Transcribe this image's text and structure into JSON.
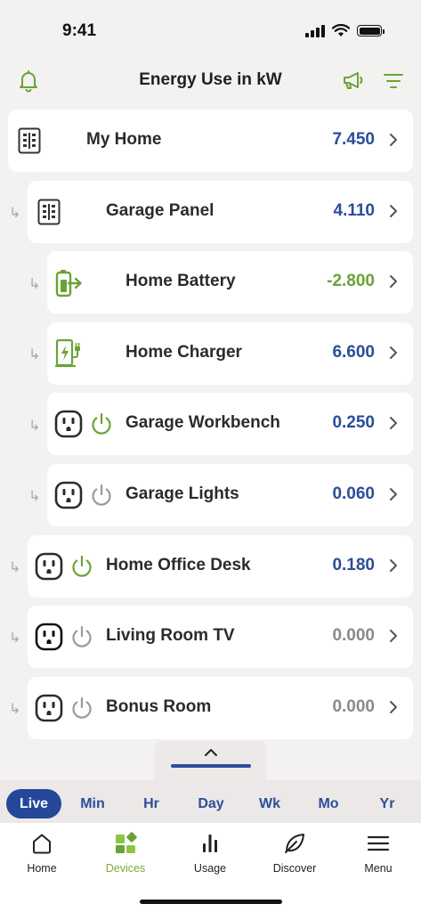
{
  "status_bar": {
    "time": "9:41"
  },
  "header": {
    "title": "Energy Use in kW"
  },
  "colors": {
    "accent_green": "#6aa335",
    "value_blue": "#2b4d9a",
    "value_gray": "#8a8a8a",
    "active_tab": "#24479a"
  },
  "devices": [
    {
      "name": "My Home",
      "value": "7.450",
      "icon": "panel-icon",
      "power": "none",
      "value_color": "blue"
    },
    {
      "name": "Garage Panel",
      "value": "4.110",
      "icon": "panel-icon",
      "power": "none",
      "value_color": "blue"
    },
    {
      "name": "Home Battery",
      "value": "-2.800",
      "icon": "battery-icon",
      "power": "none",
      "value_color": "green"
    },
    {
      "name": "Home Charger",
      "value": "6.600",
      "icon": "ev-charger-icon",
      "power": "none",
      "value_color": "blue"
    },
    {
      "name": "Garage Workbench",
      "value": "0.250",
      "icon": "outlet-icon",
      "power": "on",
      "value_color": "blue"
    },
    {
      "name": "Garage Lights",
      "value": "0.060",
      "icon": "outlet-icon",
      "power": "off",
      "value_color": "blue"
    },
    {
      "name": "Home Office Desk",
      "value": "0.180",
      "icon": "outlet-icon",
      "power": "on",
      "value_color": "blue"
    },
    {
      "name": "Living Room TV",
      "value": "0.000",
      "icon": "outlet-icon",
      "power": "off",
      "value_color": "gray"
    },
    {
      "name": "Bonus Room",
      "value": "0.000",
      "icon": "outlet-icon",
      "power": "off",
      "value_color": "gray"
    }
  ],
  "time_ranges": [
    {
      "label": "Live",
      "active": true
    },
    {
      "label": "Min",
      "active": false
    },
    {
      "label": "Hr",
      "active": false
    },
    {
      "label": "Day",
      "active": false
    },
    {
      "label": "Wk",
      "active": false
    },
    {
      "label": "Mo",
      "active": false
    },
    {
      "label": "Yr",
      "active": false
    }
  ],
  "tabs": [
    {
      "label": "Home",
      "icon": "house-icon",
      "active": false
    },
    {
      "label": "Devices",
      "icon": "devices-icon",
      "active": true
    },
    {
      "label": "Usage",
      "icon": "bar-chart-icon",
      "active": false
    },
    {
      "label": "Discover",
      "icon": "leaf-icon",
      "active": false
    },
    {
      "label": "Menu",
      "icon": "hamburger-icon",
      "active": false
    }
  ]
}
